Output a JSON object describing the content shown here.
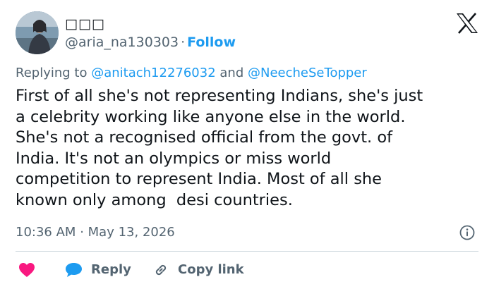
{
  "author": {
    "display_name": "□□□",
    "handle": "@aria_na130303",
    "separator": "·",
    "follow_label": "Follow"
  },
  "reply_context": {
    "prefix": "Replying to",
    "mention_1": "@anitach12276032",
    "conjunction": "and",
    "mention_2": "@NeecheSeTopper"
  },
  "tweet": {
    "lines": [
      "First of all she's not representing Indians, she's just",
      "a celebrity working like anyone else in the world.",
      "She's not a recognised official from the govt. of",
      "India. It's not an olympics or miss world",
      "competition to represent India. Most of all she",
      "known only among  desi countries."
    ]
  },
  "meta": {
    "time": "10:36 AM",
    "separator": "·",
    "date": "May 13, 2026"
  },
  "actions": {
    "reply_label": "Reply",
    "copy_link_label": "Copy link"
  },
  "icons": {
    "brand": "x-logo-icon",
    "info": "info-icon",
    "like": "heart-icon",
    "reply": "speech-bubble-icon",
    "copy": "link-icon"
  },
  "colors": {
    "accent": "#1d9bf0",
    "like": "#f91880",
    "muted": "#536471",
    "text": "#0f1419"
  }
}
